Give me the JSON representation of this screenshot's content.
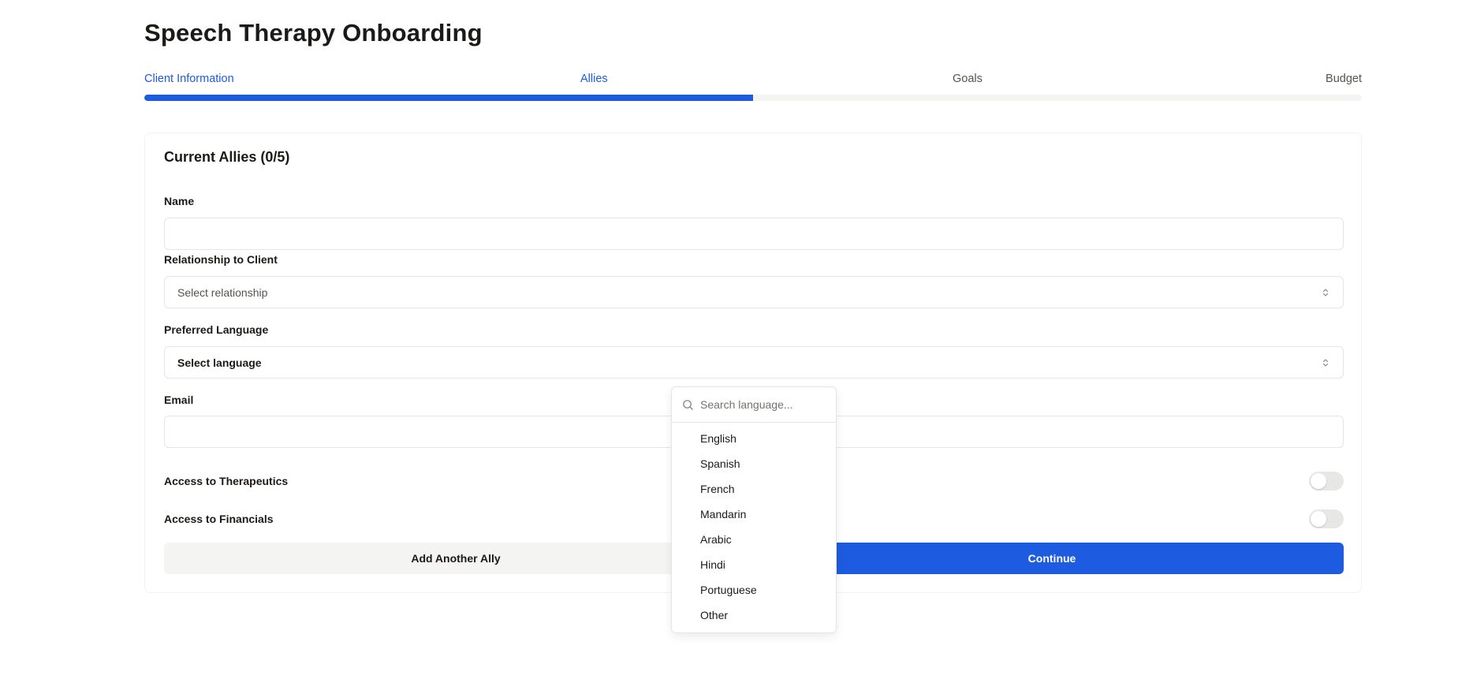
{
  "page": {
    "title": "Speech Therapy Onboarding"
  },
  "stepper": {
    "steps": [
      {
        "label": "Client Information",
        "active": true
      },
      {
        "label": "Allies",
        "active": true
      },
      {
        "label": "Goals",
        "active": false
      },
      {
        "label": "Budget",
        "active": false
      }
    ],
    "progress_fraction": 0.5
  },
  "form": {
    "section_title": "Current Allies (0/5)",
    "name": {
      "label": "Name",
      "value": ""
    },
    "relationship": {
      "label": "Relationship to Client",
      "placeholder": "Select relationship"
    },
    "language": {
      "label": "Preferred Language",
      "placeholder": "Select language"
    },
    "email": {
      "label": "Email",
      "value": ""
    },
    "therapeutics_toggle": {
      "label": "Access to Therapeutics",
      "checked": false
    },
    "financials_toggle": {
      "label": "Access to Financials",
      "checked": false
    },
    "add_ally_label": "Add Another Ally",
    "continue_label": "Continue"
  },
  "language_dropdown": {
    "search_placeholder": "Search language...",
    "options": [
      "English",
      "Spanish",
      "French",
      "Mandarin",
      "Arabic",
      "Hindi",
      "Portuguese",
      "Other"
    ]
  },
  "colors": {
    "accent": "#1d5be0",
    "text": "#1c1917",
    "muted": "#57534e",
    "track": "#f4f4f3"
  },
  "icons": {
    "select_chevrons": "chevrons-up-down-icon",
    "search": "search-icon"
  }
}
